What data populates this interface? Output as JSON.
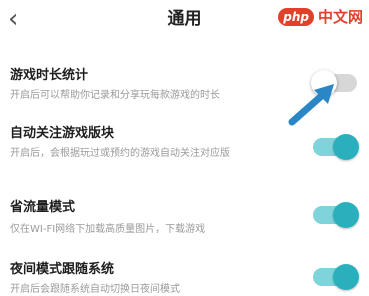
{
  "header": {
    "back_icon": "chevron-left-icon",
    "title": "通用",
    "watermark": {
      "logo": "php",
      "text": "中文网"
    }
  },
  "settings": [
    {
      "title": "游戏时长统计",
      "desc": "开启后可以帮助你记录和分享玩每款游戏的时长",
      "on": false
    },
    {
      "title": "自动关注游戏版块",
      "desc": "开启后，会根据玩过或预约的游戏自动关注对应版",
      "on": true
    },
    {
      "title": "省流量模式",
      "desc": "仅在WI-FI网络下加载高质量图片，下载游戏",
      "on": true
    },
    {
      "title": "夜间模式跟随系统",
      "desc": "开启后会跟随系统自动切换日夜间模式",
      "on": true
    }
  ],
  "colors": {
    "toggle_on": "#2ab0bd",
    "toggle_track_on": "#7fd3da",
    "toggle_off": "#d7d7d7",
    "arrow": "#2a86c4"
  }
}
